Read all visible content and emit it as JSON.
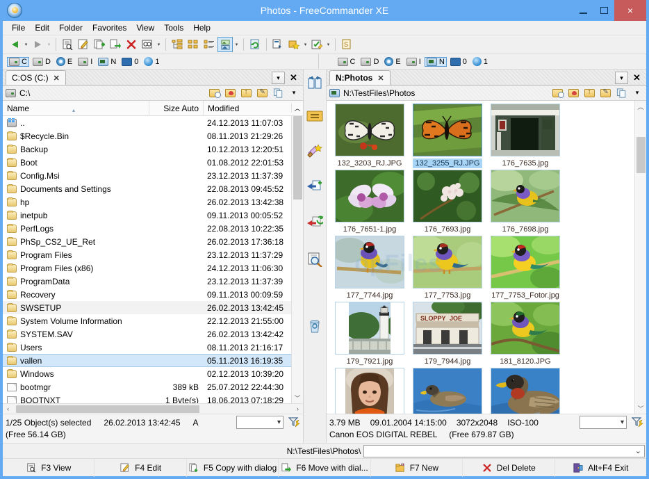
{
  "window": {
    "title": "Photos - FreeCommander XE",
    "app_icon": "app-logo-icon",
    "minimize": "–",
    "maximize": "□",
    "close": "×"
  },
  "menubar": {
    "items": [
      {
        "label": "File"
      },
      {
        "label": "Edit"
      },
      {
        "label": "Folder"
      },
      {
        "label": "Favorites"
      },
      {
        "label": "View"
      },
      {
        "label": "Tools"
      },
      {
        "label": "Help"
      }
    ]
  },
  "toolbar": {
    "buttons": [
      {
        "name": "back-button",
        "glyph": "⬅"
      },
      {
        "name": "back-dropdown",
        "glyph": "▾"
      },
      {
        "name": "forward-button",
        "glyph": "➡"
      },
      {
        "name": "forward-dropdown",
        "glyph": "▾"
      },
      {
        "name": "view-file-button",
        "glyph": "☰"
      },
      {
        "name": "edit-file-button",
        "glyph": "✎"
      },
      {
        "name": "copy-file-button",
        "glyph": "➕"
      },
      {
        "name": "move-file-button",
        "glyph": "➡"
      },
      {
        "name": "delete-file-button",
        "glyph": "✕"
      },
      {
        "name": "search-button",
        "glyph": "🔍"
      },
      {
        "name": "search-dropdown",
        "glyph": "▾"
      },
      {
        "name": "tree-view-button",
        "glyph": "⎇"
      },
      {
        "name": "large-icons-view-button",
        "glyph": "▦"
      },
      {
        "name": "details-view-button",
        "glyph": "≡"
      },
      {
        "name": "thumbnail-view-button",
        "glyph": "▣"
      },
      {
        "name": "view-dropdown",
        "glyph": "▾"
      },
      {
        "name": "refresh-button",
        "glyph": "↻"
      },
      {
        "name": "open-with-button",
        "glyph": "▶"
      },
      {
        "name": "favorites-button",
        "glyph": "★"
      },
      {
        "name": "favorites-dropdown",
        "glyph": "▾"
      },
      {
        "name": "multi-rename-button",
        "glyph": "☑"
      },
      {
        "name": "multi-rename-dropdown",
        "glyph": "▾"
      },
      {
        "name": "sync-button",
        "glyph": "S"
      }
    ]
  },
  "drives": {
    "left": [
      {
        "letter": "C",
        "type": "hdd",
        "selected": true
      },
      {
        "letter": "D",
        "type": "removable",
        "selected": false
      },
      {
        "letter": "E",
        "type": "cd",
        "selected": false
      },
      {
        "letter": "I",
        "type": "removable",
        "selected": false
      },
      {
        "letter": "N",
        "type": "network",
        "selected": false
      },
      {
        "letter": "0",
        "type": "monitor",
        "selected": false
      },
      {
        "letter": "1",
        "type": "globe",
        "selected": false
      }
    ],
    "right": [
      {
        "letter": "C",
        "type": "hdd",
        "selected": false
      },
      {
        "letter": "D",
        "type": "removable",
        "selected": false
      },
      {
        "letter": "E",
        "type": "cd",
        "selected": false
      },
      {
        "letter": "I",
        "type": "removable",
        "selected": false
      },
      {
        "letter": "N",
        "type": "network",
        "selected": true
      },
      {
        "letter": "0",
        "type": "monitor",
        "selected": false
      },
      {
        "letter": "1",
        "type": "globe",
        "selected": false
      }
    ]
  },
  "midbar": {
    "buttons": [
      {
        "name": "swap-panels-button",
        "glyph": "⇄"
      },
      {
        "name": "same-folder-button",
        "glyph": "="
      },
      {
        "name": "favorite-tools-button",
        "glyph": "⚒"
      },
      {
        "name": "copy-to-left-button",
        "glyph": "←"
      },
      {
        "name": "move-to-left-button",
        "glyph": "⇐"
      },
      {
        "name": "compare-folders-button",
        "glyph": "🔎"
      },
      {
        "name": "recycle-bin-button",
        "glyph": "🗑"
      }
    ]
  },
  "left_panel": {
    "tab": {
      "label": "C:OS (C:)",
      "close": "✕"
    },
    "tabstrip_buttons": [
      {
        "name": "tab-list-button",
        "glyph": "▾"
      },
      {
        "name": "close-tab-button",
        "glyph": "✕"
      }
    ],
    "path": "C:\\",
    "path_icon": "hdd-icon",
    "path_buttons": [
      {
        "name": "history-folder-icon",
        "glyph": "◴"
      },
      {
        "name": "favorites-folder-icon",
        "glyph": "♥"
      },
      {
        "name": "parent-folder-icon",
        "glyph": "↑"
      },
      {
        "name": "open-folder-icon",
        "glyph": "↗"
      },
      {
        "name": "copy-path-icon",
        "glyph": "⧉"
      },
      {
        "name": "path-dropdown-icon",
        "glyph": "▾"
      }
    ],
    "columns": [
      {
        "label": "Name",
        "key": "name"
      },
      {
        "label": "Size Auto",
        "key": "size"
      },
      {
        "label": "Modified",
        "key": "modified"
      }
    ],
    "sort_indicator": "▴",
    "rows": [
      {
        "icon": "updir",
        "name": "..",
        "size": "",
        "modified": "24.12.2013 11:07:03",
        "state": ""
      },
      {
        "icon": "folder",
        "name": "$Recycle.Bin",
        "size": "",
        "modified": "08.11.2013 21:29:26",
        "state": ""
      },
      {
        "icon": "folder",
        "name": "Backup",
        "size": "",
        "modified": "10.12.2013 12:20:51",
        "state": ""
      },
      {
        "icon": "folder",
        "name": "Boot",
        "size": "",
        "modified": "01.08.2012 22:01:53",
        "state": ""
      },
      {
        "icon": "folder",
        "name": "Config.Msi",
        "size": "",
        "modified": "23.12.2013 11:37:39",
        "state": ""
      },
      {
        "icon": "folder",
        "name": "Documents and Settings",
        "size": "",
        "modified": "22.08.2013 09:45:52",
        "state": ""
      },
      {
        "icon": "folder",
        "name": "hp",
        "size": "",
        "modified": "26.02.2013 13:42:38",
        "state": ""
      },
      {
        "icon": "folder",
        "name": "inetpub",
        "size": "",
        "modified": "09.11.2013 00:05:52",
        "state": ""
      },
      {
        "icon": "folder",
        "name": "PerfLogs",
        "size": "",
        "modified": "22.08.2013 10:22:35",
        "state": ""
      },
      {
        "icon": "folder",
        "name": "PhSp_CS2_UE_Ret",
        "size": "",
        "modified": "26.02.2013 17:36:18",
        "state": ""
      },
      {
        "icon": "folder",
        "name": "Program Files",
        "size": "",
        "modified": "23.12.2013 11:37:29",
        "state": ""
      },
      {
        "icon": "folder",
        "name": "Program Files (x86)",
        "size": "",
        "modified": "24.12.2013 11:06:30",
        "state": ""
      },
      {
        "icon": "folder",
        "name": "ProgramData",
        "size": "",
        "modified": "23.12.2013 11:37:39",
        "state": ""
      },
      {
        "icon": "folder",
        "name": "Recovery",
        "size": "",
        "modified": "09.11.2013 00:09:59",
        "state": ""
      },
      {
        "icon": "folder",
        "name": "SWSETUP",
        "size": "",
        "modified": "26.02.2013 13:42:45",
        "state": "sel-soft"
      },
      {
        "icon": "folder",
        "name": "System Volume Information",
        "size": "",
        "modified": "22.12.2013 21:55:00",
        "state": ""
      },
      {
        "icon": "folder",
        "name": "SYSTEM.SAV",
        "size": "",
        "modified": "26.02.2013 13:42:42",
        "state": ""
      },
      {
        "icon": "folder",
        "name": "Users",
        "size": "",
        "modified": "08.11.2013 21:16:17",
        "state": ""
      },
      {
        "icon": "folder",
        "name": "vallen",
        "size": "",
        "modified": "05.11.2013 16:19:35",
        "state": "sel-blue"
      },
      {
        "icon": "folder",
        "name": "Windows",
        "size": "",
        "modified": "02.12.2013 10:39:20",
        "state": ""
      },
      {
        "icon": "file",
        "name": "bootmgr",
        "size": "389 kB",
        "modified": "25.07.2012 22:44:30",
        "state": ""
      },
      {
        "icon": "file",
        "name": "BOOTNXT",
        "size": "1 Byte(s)",
        "modified": "18.06.2013 07:18:29",
        "state": ""
      }
    ],
    "status": {
      "selection": "1/25 Object(s) selected",
      "modified": "26.02.2013 13:42:45",
      "attributes": "A",
      "free": "(Free 56.14 GB)",
      "filter_value": "",
      "filter_dropdown": "▾",
      "filter_icon": "filter-icon"
    }
  },
  "right_panel": {
    "tab": {
      "label": "N:Photos",
      "close": "✕"
    },
    "tabstrip_buttons": [
      {
        "name": "tab-list-button",
        "glyph": "▾"
      },
      {
        "name": "close-tab-button",
        "glyph": "✕"
      }
    ],
    "path": "N:\\TestFiles\\Photos",
    "path_icon": "network-drive-icon",
    "path_buttons": [
      {
        "name": "history-folder-icon",
        "glyph": "◴"
      },
      {
        "name": "favorites-folder-icon",
        "glyph": "♥"
      },
      {
        "name": "parent-folder-icon",
        "glyph": "↑"
      },
      {
        "name": "open-folder-icon",
        "glyph": "↗"
      },
      {
        "name": "copy-path-icon",
        "glyph": "⧉"
      },
      {
        "name": "path-dropdown-icon",
        "glyph": "▾"
      }
    ],
    "thumbnails": [
      {
        "name": "132_3203_RJ.JPG",
        "kind": "butterfly-white",
        "selected": false
      },
      {
        "name": "132_3255_RJ.JPG",
        "kind": "butterfly-orange",
        "selected": true
      },
      {
        "name": "176_7635.jpg",
        "kind": "building",
        "selected": false
      },
      {
        "name": "176_7651-1.jpg",
        "kind": "orchid",
        "selected": false
      },
      {
        "name": "176_7693.jpg",
        "kind": "blossom",
        "selected": false
      },
      {
        "name": "176_7698.jpg",
        "kind": "finch-leaf",
        "selected": false
      },
      {
        "name": "177_7744.jpg",
        "kind": "finch-red",
        "selected": false
      },
      {
        "name": "177_7753.jpg",
        "kind": "finch-branch",
        "selected": false
      },
      {
        "name": "177_7753_Fotor.jpg",
        "kind": "finch-bright",
        "selected": false
      },
      {
        "name": "179_7921.jpg",
        "kind": "lighthouse",
        "selected": false
      },
      {
        "name": "179_7944.jpg",
        "kind": "sloppy-joes",
        "selected": false
      },
      {
        "name": "181_8120.JPG",
        "kind": "finch-green",
        "selected": false
      },
      {
        "name": "",
        "kind": "girl",
        "selected": false
      },
      {
        "name": "",
        "kind": "duck-small",
        "selected": false
      },
      {
        "name": "",
        "kind": "duck-large",
        "selected": false
      },
      {
        "name": "",
        "kind": "duck-large2",
        "selected": false
      }
    ],
    "status": {
      "size": "3.79 MB",
      "date": "09.01.2004 14:15:00",
      "dimensions": "3072x2048",
      "iso": "ISO-100",
      "camera": "Canon EOS DIGITAL REBEL",
      "free": "(Free 679.87 GB)",
      "filter_value": "",
      "filter_dropdown": "▾",
      "filter_icon": "filter-icon"
    }
  },
  "watermark": "opFiles",
  "command_line": {
    "prompt": "N:\\TestFiles\\Photos\\",
    "value": "",
    "dropdown": "⌄"
  },
  "function_bar": {
    "buttons": [
      {
        "label": "F3 View",
        "icon": "view-icon"
      },
      {
        "label": "F4 Edit",
        "icon": "edit-icon"
      },
      {
        "label": "F5 Copy with dialog",
        "icon": "copy-icon"
      },
      {
        "label": "F6 Move with dial...",
        "icon": "move-icon"
      },
      {
        "label": "F7 New",
        "icon": "new-folder-icon"
      },
      {
        "label": "Del Delete",
        "icon": "delete-icon"
      },
      {
        "label": "Alt+F4 Exit",
        "icon": "exit-icon"
      }
    ]
  },
  "colors": {
    "titlebar": "#64aaf2",
    "close_button": "#c75b5b",
    "selection": "#a8d4f5",
    "row_selection": "#d2e7fa",
    "panel_bg": "#f0f0f0",
    "list_bg": "#ffffff"
  }
}
